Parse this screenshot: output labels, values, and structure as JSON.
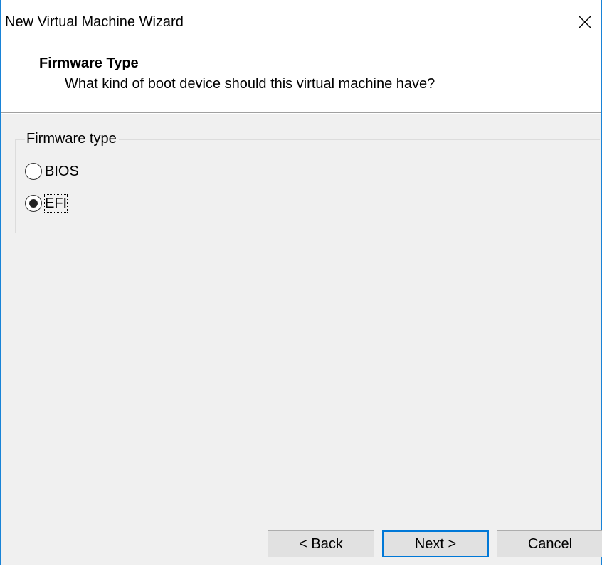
{
  "window": {
    "title": "New Virtual Machine Wizard",
    "close_icon": "close-icon",
    "accent_color": "#1883d7"
  },
  "header": {
    "title": "Firmware Type",
    "subtitle": "What kind of boot device should this virtual machine have?"
  },
  "firmware_group": {
    "legend": "Firmware type",
    "options": [
      {
        "label": "BIOS",
        "selected": false
      },
      {
        "label": "EFI",
        "selected": true,
        "focused": true
      }
    ]
  },
  "footer": {
    "back_label": "< Back",
    "next_label": "Next >",
    "cancel_label": "Cancel",
    "default_button_color": "#0078d7"
  }
}
